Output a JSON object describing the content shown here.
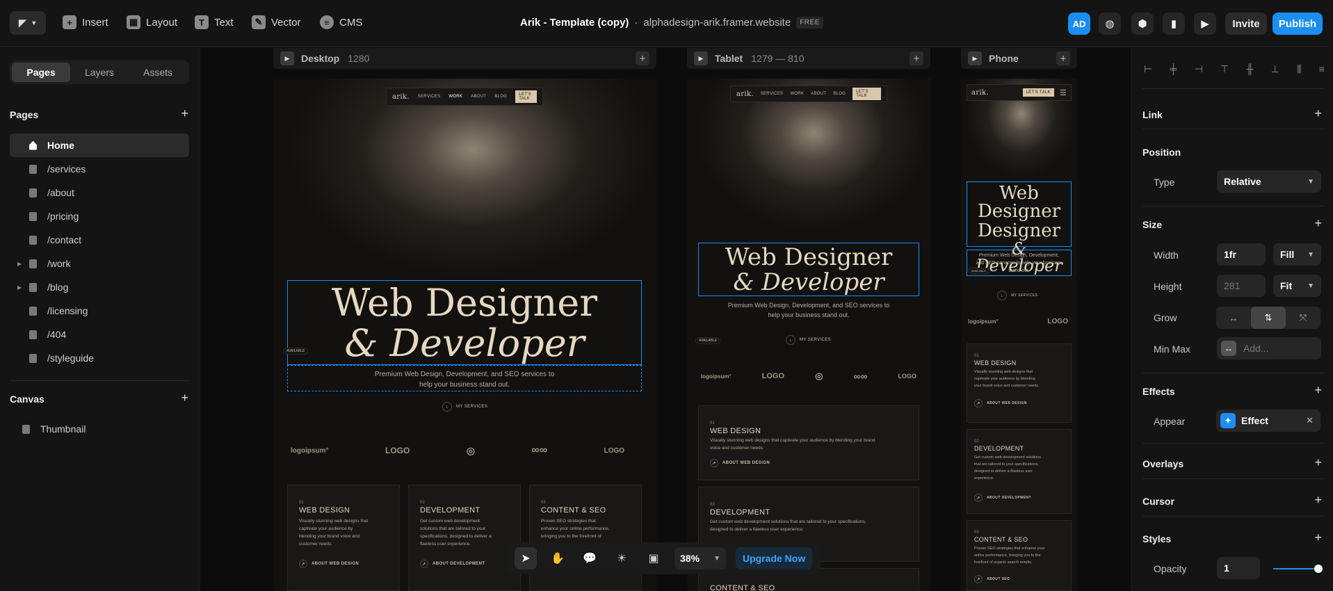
{
  "toolbar": {
    "insert": "Insert",
    "layout": "Layout",
    "text": "Text",
    "vector": "Vector",
    "cms": "CMS",
    "project_title": "Arik - Template (copy)",
    "dot": "·",
    "domain": "alphadesign-arik.framer.website",
    "plan_badge": "FREE",
    "avatar_initials": "AD",
    "invite": "Invite",
    "publish": "Publish"
  },
  "left_panel": {
    "tabs": [
      "Pages",
      "Layers",
      "Assets"
    ],
    "active_tab": "Pages",
    "pages_heading": "Pages",
    "pages": [
      {
        "label": "Home",
        "active": true
      },
      {
        "label": "/services"
      },
      {
        "label": "/about"
      },
      {
        "label": "/pricing"
      },
      {
        "label": "/contact"
      },
      {
        "label": "/work",
        "expandable": true
      },
      {
        "label": "/blog",
        "expandable": true
      },
      {
        "label": "/licensing"
      },
      {
        "label": "/404"
      },
      {
        "label": "/styleguide"
      }
    ],
    "canvas_heading": "Canvas",
    "canvas_items": [
      "Thumbnail"
    ]
  },
  "canvas": {
    "breakpoints": [
      {
        "name": "Desktop",
        "size": "1280"
      },
      {
        "name": "Tablet",
        "size": "1279 — 810"
      },
      {
        "name": "Phone",
        "size": ""
      }
    ],
    "site": {
      "brand": "arik.",
      "nav": [
        "SERVICES",
        "WORK",
        "ABOUT",
        "BLOG"
      ],
      "cta": "LET'S TALK",
      "headline_line1": "Web Designer",
      "headline_line2": "& Developer",
      "subtext_desktop_1": "Premium Web Design, Development, and SEO services to",
      "subtext_desktop_2": "help your business stand out.",
      "subtext_tablet_1": "Premium Web Design, Development, and SEO services to",
      "subtext_tablet_2": "help your business stand out.",
      "subtext_phone_1": "Premium Web Design, Development,",
      "subtext_phone_2": "and SEO services to help your business",
      "subtext_phone_3": "stand out.",
      "available": "AVAILABLE",
      "my_services": "MY SERVICES",
      "logos": [
        "logoipsum°",
        "LOGO",
        "◎",
        "∞∞",
        "LOGO"
      ],
      "services": [
        {
          "num": "01",
          "title": "WEB DESIGN",
          "desc_desktop": [
            "Visually stunning web designs that",
            "captivate your audience by",
            "blending your brand voice and",
            "customer needs."
          ],
          "desc_tablet": [
            "Visually stunning web designs that captivate your audience by blending your brand",
            "voice and customer needs."
          ],
          "desc_phone": [
            "Visually stunning web designs that",
            "captivate your audience by blending",
            "your brand voice and customer needs."
          ],
          "link": "ABOUT WEB DESIGN"
        },
        {
          "num": "02",
          "title": "DEVELOPMENT",
          "desc_desktop": [
            "Get custom web development",
            "solutions that are tailored to your",
            "specifications, designed to deliver a",
            "flawless user experience."
          ],
          "desc_tablet": [
            "Get custom web development solutions that are tailored to your specifications,",
            "designed to deliver a flawless user experience."
          ],
          "desc_phone": [
            "Get custom web development solutions",
            "that are tailored to your specifications,",
            "designed to deliver a flawless user",
            "experience."
          ],
          "link": "ABOUT DEVELOPMENT"
        },
        {
          "num": "03",
          "title": "CONTENT & SEO",
          "desc_desktop": [
            "Proven SEO strategies that",
            "enhance your online performance,",
            "bringing you to the forefront of"
          ],
          "desc_phone": [
            "Proven SEO strategies that enhance your",
            "online performance, bringing you to the",
            "forefront of organic search results."
          ],
          "link": "ABOUT SEO"
        }
      ]
    }
  },
  "bottom_bar": {
    "zoom": "38%",
    "upgrade": "Upgrade Now"
  },
  "right_panel": {
    "link": "Link",
    "position": "Position",
    "type_label": "Type",
    "type_value": "Relative",
    "size": "Size",
    "width_label": "Width",
    "width_value": "1fr",
    "width_mode": "Fill",
    "height_label": "Height",
    "height_placeholder": "281",
    "height_mode": "Fit",
    "grow_label": "Grow",
    "minmax_label": "Min Max",
    "minmax_placeholder": "Add...",
    "effects": "Effects",
    "appear_label": "Appear",
    "effect_value": "Effect",
    "overlays": "Overlays",
    "cursor": "Cursor",
    "styles": "Styles",
    "opacity_label": "Opacity",
    "opacity_value": "1"
  },
  "colors": {
    "accent": "#1b8ef2",
    "site_bg": "#121110",
    "site_text": "#e6d8c0",
    "cta_bg": "#d9c7aa"
  }
}
